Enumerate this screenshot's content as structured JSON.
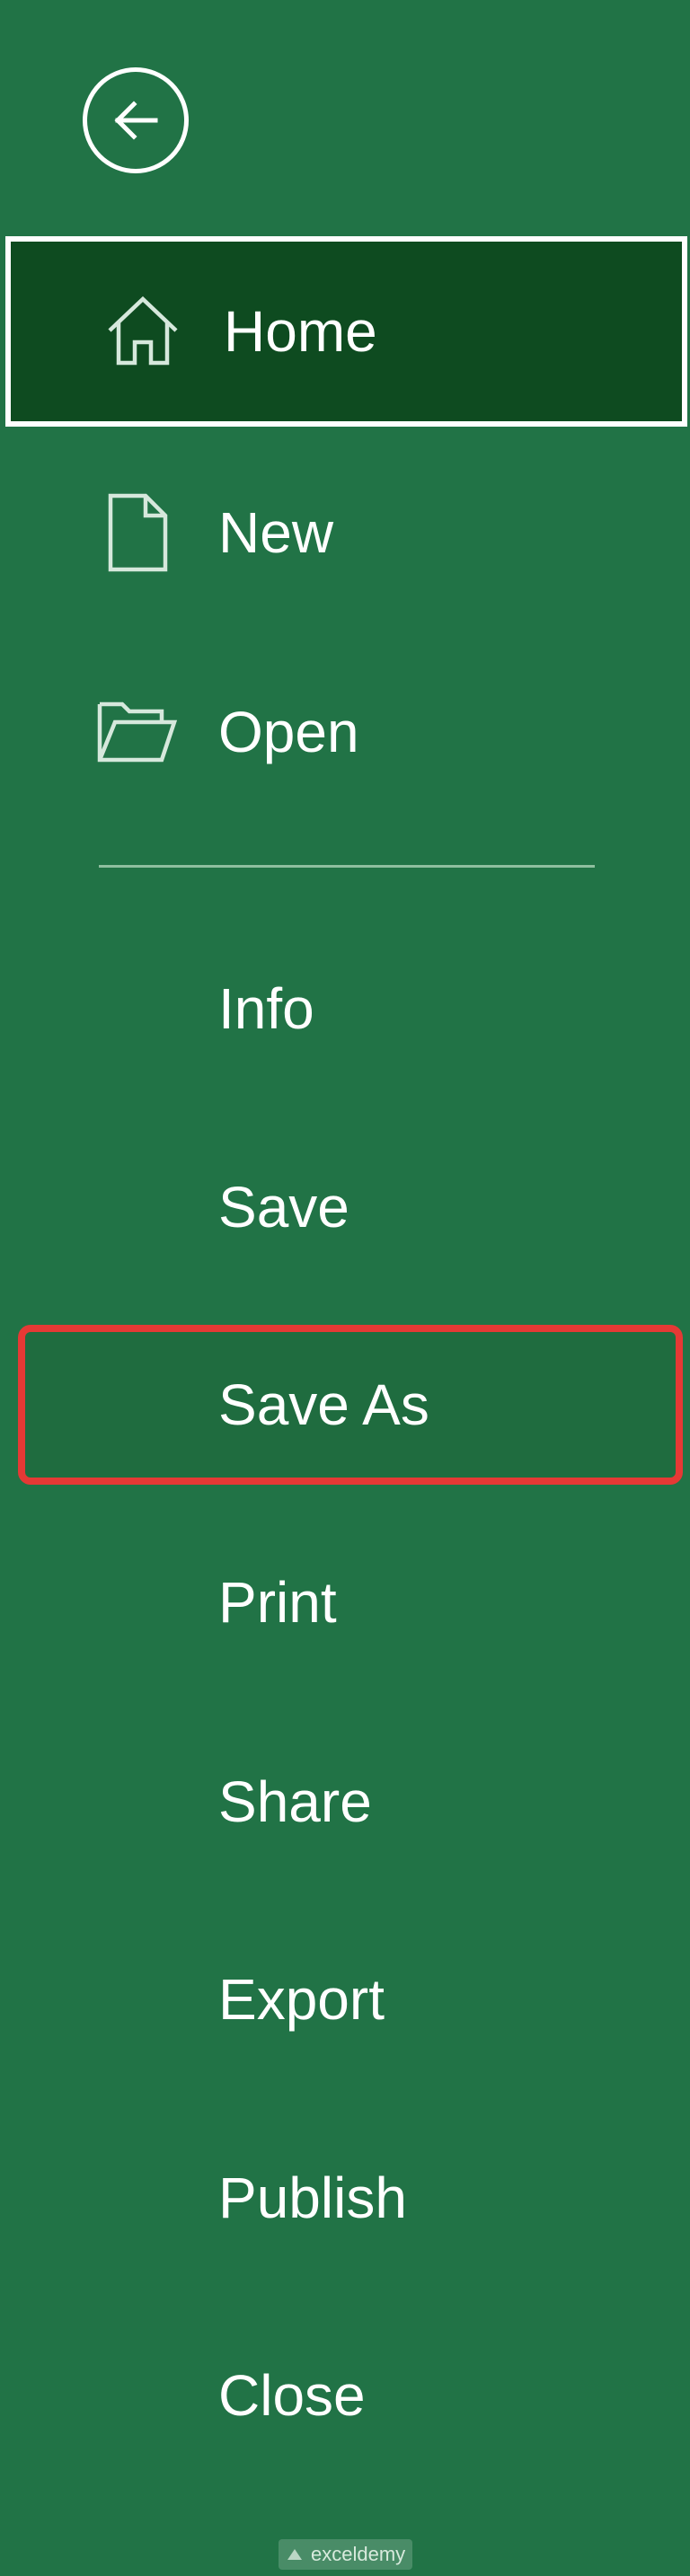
{
  "back": {
    "icon": "back-arrow-icon"
  },
  "menu": {
    "home": {
      "label": "Home",
      "icon": "home-icon"
    },
    "new": {
      "label": "New",
      "icon": "new-document-icon"
    },
    "open": {
      "label": "Open",
      "icon": "open-folder-icon"
    },
    "info": {
      "label": "Info"
    },
    "save": {
      "label": "Save"
    },
    "save_as": {
      "label": "Save As"
    },
    "print": {
      "label": "Print"
    },
    "share": {
      "label": "Share"
    },
    "export": {
      "label": "Export"
    },
    "publish": {
      "label": "Publish"
    },
    "close": {
      "label": "Close"
    }
  },
  "watermark": {
    "text": "exceldemy"
  },
  "colors": {
    "background": "#217346",
    "selected_background": "#0e4b20",
    "highlight_border": "#e53935",
    "text": "#ffffff"
  }
}
